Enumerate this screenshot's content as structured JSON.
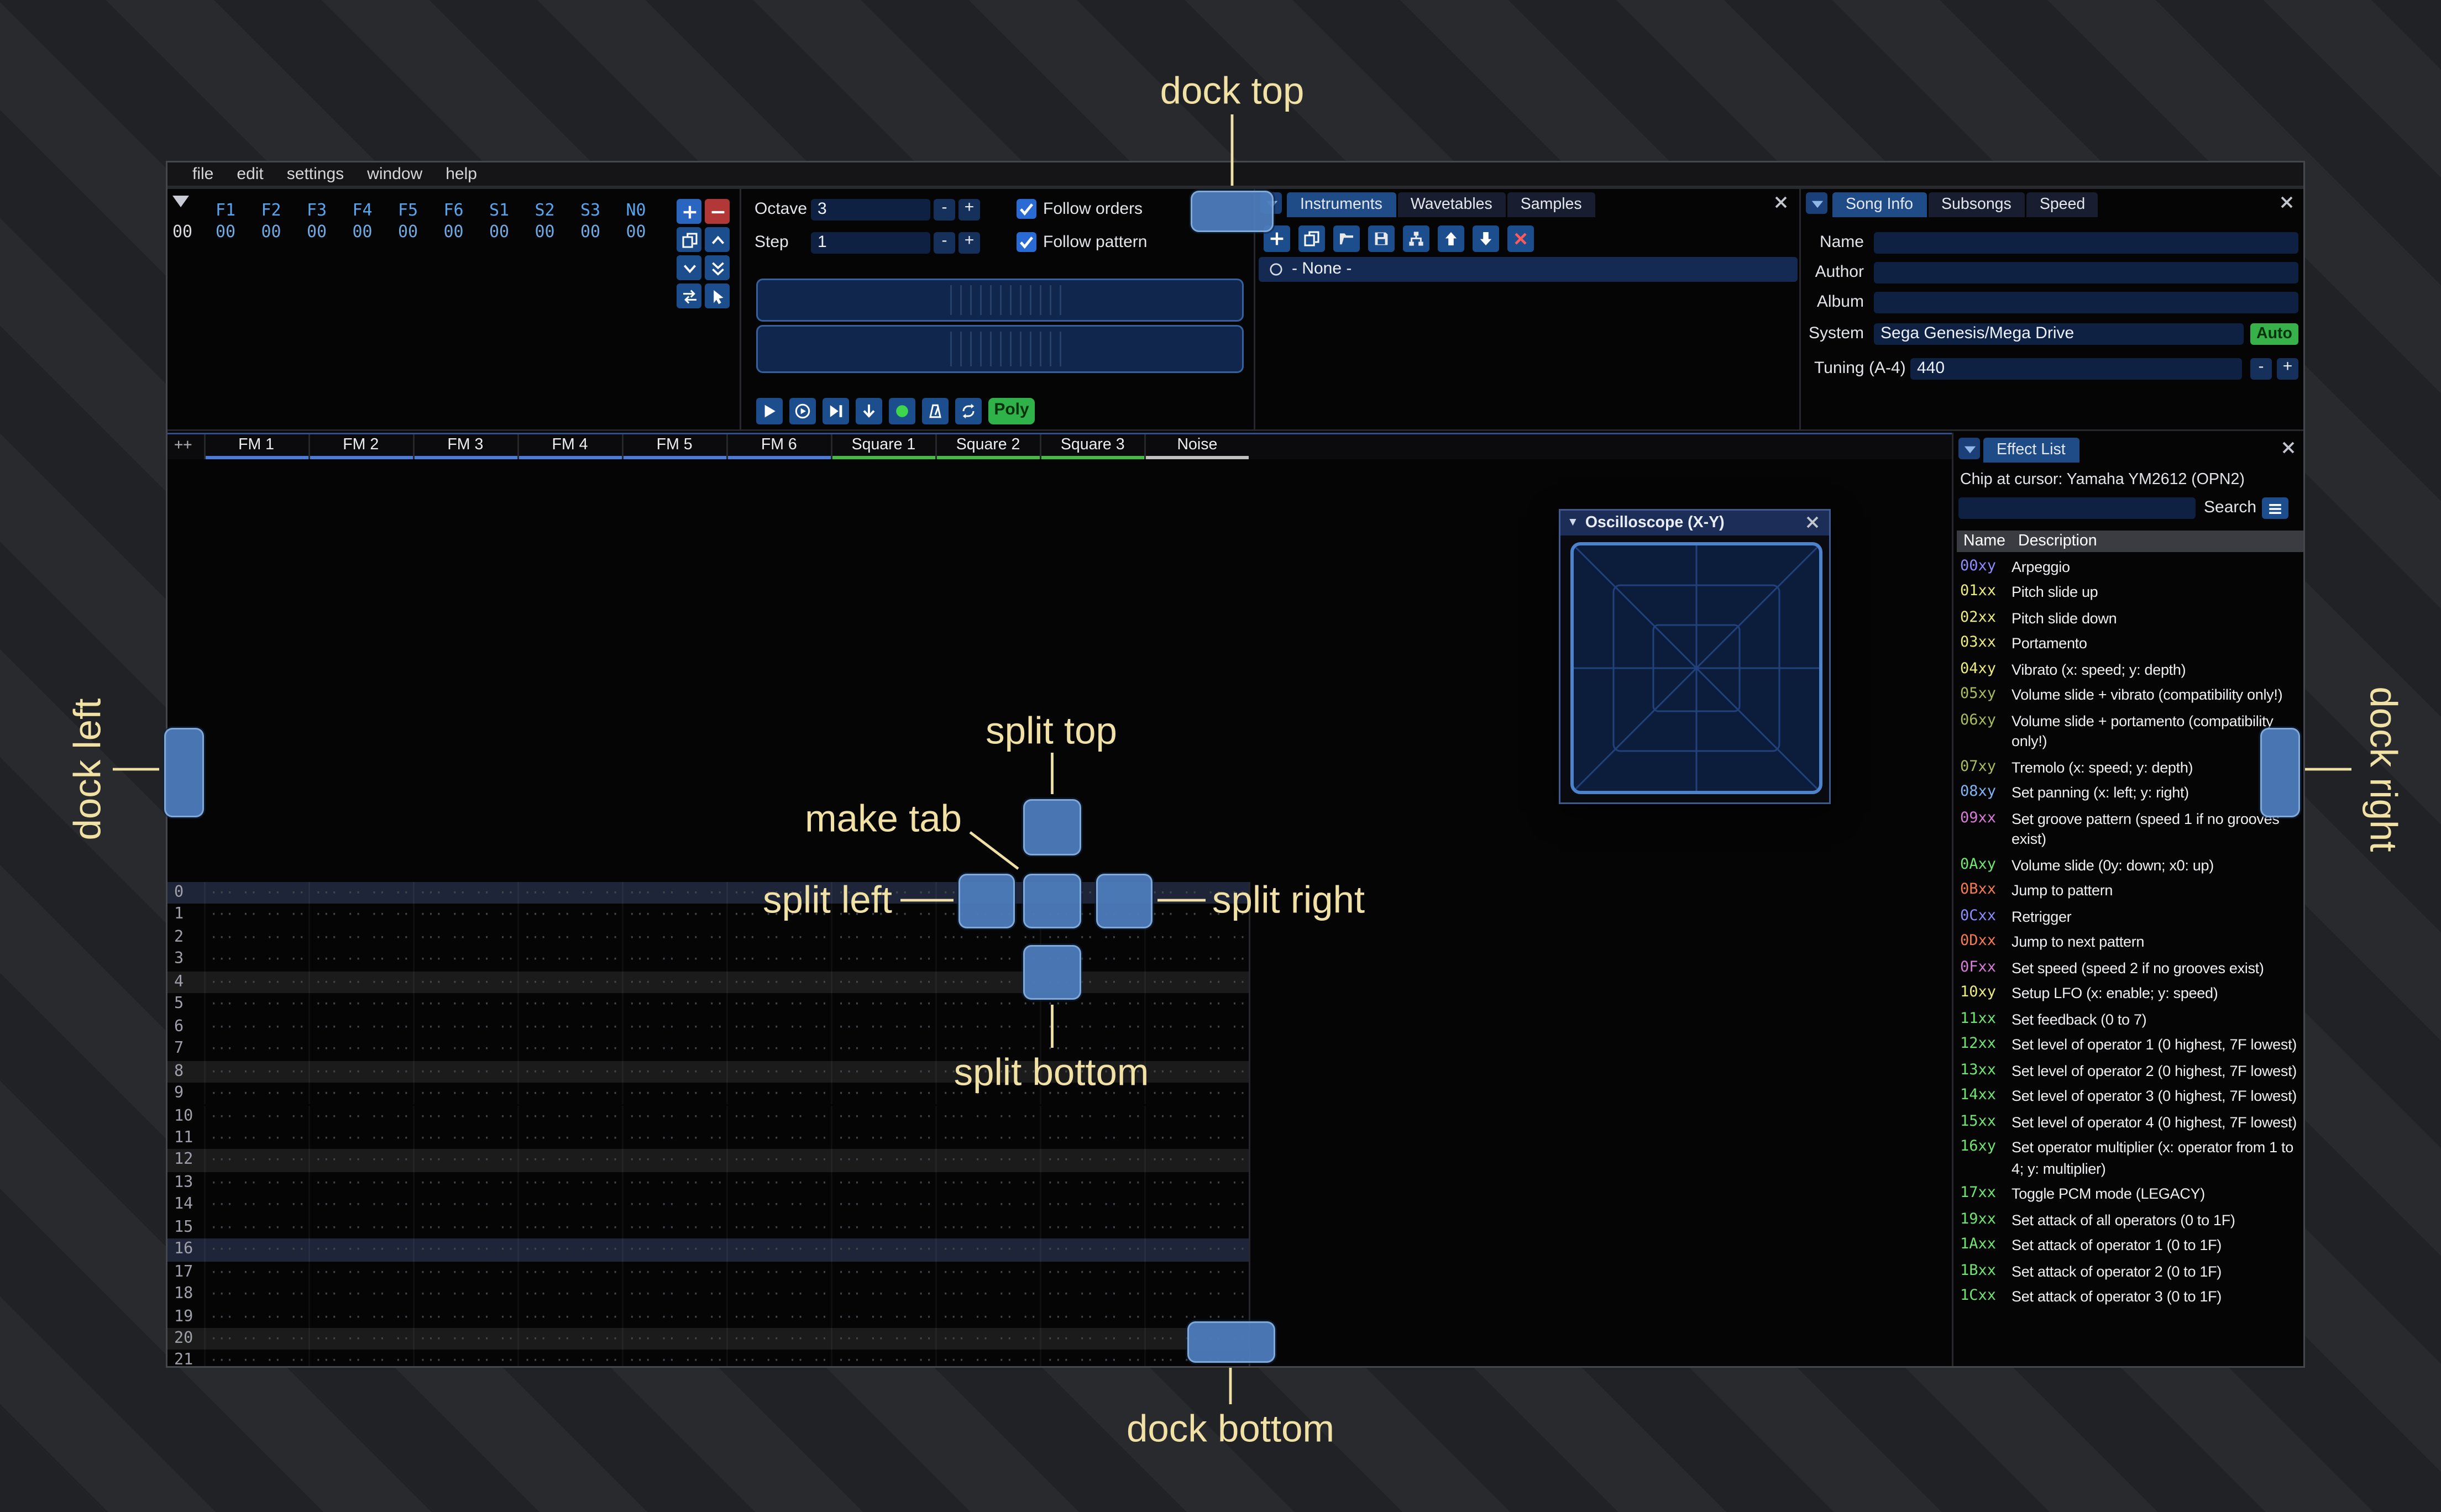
{
  "menu": {
    "items": [
      "file",
      "edit",
      "settings",
      "window",
      "help"
    ]
  },
  "orders": {
    "columns": [
      "F1",
      "F2",
      "F3",
      "F4",
      "F5",
      "F6",
      "S1",
      "S2",
      "S3",
      "N0"
    ],
    "rows": [
      {
        "label": "00",
        "values": [
          "00",
          "00",
          "00",
          "00",
          "00",
          "00",
          "00",
          "00",
          "00",
          "00"
        ]
      }
    ],
    "buttons": [
      {
        "name": "add-order-button",
        "icon": "plus"
      },
      {
        "name": "remove-order-button",
        "icon": "minus"
      },
      {
        "name": "duplicate-order-button",
        "icon": "copy"
      },
      {
        "name": "move-order-up-button",
        "icon": "chevron-up"
      },
      {
        "name": "move-order-down-button",
        "icon": "chevron-down"
      },
      {
        "name": "duplicate-order-end-button",
        "icon": "double-chevron-down"
      },
      {
        "name": "order-change-mode-button",
        "icon": "swap"
      },
      {
        "name": "order-edit-mode-button",
        "icon": "pointer"
      }
    ]
  },
  "controls": {
    "octave_label": "Octave",
    "octave_value": "3",
    "step_label": "Step",
    "step_value": "1",
    "minus_label": "-",
    "plus_label": "+",
    "follow_orders_label": "Follow orders",
    "follow_pattern_label": "Follow pattern",
    "poly_label": "Poly",
    "transport": [
      {
        "name": "play-button",
        "icon": "play"
      },
      {
        "name": "play-song-button",
        "icon": "play-circle"
      },
      {
        "name": "play-row-button",
        "icon": "step-row"
      },
      {
        "name": "step-down-button",
        "icon": "arrow-down"
      },
      {
        "name": "record-button",
        "icon": "record"
      },
      {
        "name": "metronome-button",
        "icon": "metronome"
      },
      {
        "name": "repeat-button",
        "icon": "repeat"
      }
    ]
  },
  "instruments": {
    "tabs": [
      {
        "label": "Instruments",
        "active": true
      },
      {
        "label": "Wavetables",
        "active": false
      },
      {
        "label": "Samples",
        "active": false
      }
    ],
    "toolbar": [
      {
        "name": "add-instrument-button",
        "icon": "plus"
      },
      {
        "name": "duplicate-instrument-button",
        "icon": "copy"
      },
      {
        "name": "open-instrument-button",
        "icon": "folder-open"
      },
      {
        "name": "save-instrument-button",
        "icon": "save"
      },
      {
        "name": "instrument-folders-button",
        "icon": "tree"
      },
      {
        "name": "move-instrument-up-button",
        "icon": "arrow-up-full"
      },
      {
        "name": "move-instrument-down-button",
        "icon": "arrow-down-full"
      },
      {
        "name": "delete-instrument-button",
        "icon": "close-red"
      }
    ],
    "items": [
      {
        "label": "- None -",
        "selected": true
      }
    ]
  },
  "song_info": {
    "tabs": [
      {
        "label": "Song Info",
        "active": true
      },
      {
        "label": "Subsongs",
        "active": false
      },
      {
        "label": "Speed",
        "active": false
      }
    ],
    "fields": [
      {
        "label": "Name",
        "value": ""
      },
      {
        "label": "Author",
        "value": ""
      },
      {
        "label": "Album",
        "value": ""
      },
      {
        "label": "System",
        "value": "Sega Genesis/Mega Drive",
        "button": "Auto"
      },
      {
        "label": "Tuning (A-4)",
        "value": "440",
        "stepper": true
      }
    ]
  },
  "pattern": {
    "expand_label": "++",
    "channels": [
      {
        "name": "FM 1",
        "color": "#4a7cdd"
      },
      {
        "name": "FM 2",
        "color": "#4a7cdd"
      },
      {
        "name": "FM 3",
        "color": "#4a7cdd"
      },
      {
        "name": "FM 4",
        "color": "#4a7cdd"
      },
      {
        "name": "FM 5",
        "color": "#4a7cdd"
      },
      {
        "name": "FM 6",
        "color": "#4a7cdd"
      },
      {
        "name": "Square 1",
        "color": "#42bd42"
      },
      {
        "name": "Square 2",
        "color": "#42bd42"
      },
      {
        "name": "Square 3",
        "color": "#42bd42"
      },
      {
        "name": "Noise",
        "color": "#c0c0c0"
      }
    ],
    "visible_rows": [
      "0",
      "1",
      "2",
      "3",
      "4",
      "5",
      "6",
      "7",
      "8",
      "9",
      "10",
      "11",
      "12",
      "13",
      "14",
      "15",
      "16",
      "17",
      "18",
      "19",
      "20",
      "21"
    ],
    "empty_cell": "··· ·· ·· ···"
  },
  "oscilloscope": {
    "title": "Oscilloscope (X-Y)"
  },
  "effect_list": {
    "title": "Effect List",
    "chip_label": "Chip at cursor: Yamaha YM2612 (OPN2)",
    "search_label": "Search",
    "search_value": "",
    "columns": [
      "Name",
      "Description"
    ],
    "effects": [
      {
        "code": "00xy",
        "desc": "Arpeggio",
        "color": "#8c8cff"
      },
      {
        "code": "01xx",
        "desc": "Pitch slide up",
        "color": "#ecec7c"
      },
      {
        "code": "02xx",
        "desc": "Pitch slide down",
        "color": "#ecec7c"
      },
      {
        "code": "03xx",
        "desc": "Portamento",
        "color": "#ecec7c"
      },
      {
        "code": "04xy",
        "desc": "Vibrato (x: speed; y: depth)",
        "color": "#ecec7c"
      },
      {
        "code": "05xy",
        "desc": "Volume slide + vibrato (compatibility only!)",
        "color": "#a8bc59"
      },
      {
        "code": "06xy",
        "desc": "Volume slide + portamento (compatibility only!)",
        "color": "#a8bc59"
      },
      {
        "code": "07xy",
        "desc": "Tremolo (x: speed; y: depth)",
        "color": "#a8bc59"
      },
      {
        "code": "08xy",
        "desc": "Set panning (x: left; y: right)",
        "color": "#7fb4f5"
      },
      {
        "code": "09xx",
        "desc": "Set groove pattern (speed 1 if no grooves exist)",
        "color": "#d87ad8"
      },
      {
        "code": "0Axy",
        "desc": "Volume slide (0y: down; x0: up)",
        "color": "#6fe66f"
      },
      {
        "code": "0Bxx",
        "desc": "Jump to pattern",
        "color": "#f57a52"
      },
      {
        "code": "0Cxx",
        "desc": "Retrigger",
        "color": "#8c8cff"
      },
      {
        "code": "0Dxx",
        "desc": "Jump to next pattern",
        "color": "#f57a52"
      },
      {
        "code": "0Fxx",
        "desc": "Set speed (speed 2 if no grooves exist)",
        "color": "#d87ad8"
      },
      {
        "code": "10xy",
        "desc": "Setup LFO (x: enable; y: speed)",
        "color": "#ecec7c"
      },
      {
        "code": "11xx",
        "desc": "Set feedback (0 to 7)",
        "color": "#6fe66f"
      },
      {
        "code": "12xx",
        "desc": "Set level of operator 1 (0 highest, 7F lowest)",
        "color": "#6fe66f"
      },
      {
        "code": "13xx",
        "desc": "Set level of operator 2 (0 highest, 7F lowest)",
        "color": "#6fe66f"
      },
      {
        "code": "14xx",
        "desc": "Set level of operator 3 (0 highest, 7F lowest)",
        "color": "#6fe66f"
      },
      {
        "code": "15xx",
        "desc": "Set level of operator 4 (0 highest, 7F lowest)",
        "color": "#6fe66f"
      },
      {
        "code": "16xy",
        "desc": "Set operator multiplier (x: operator from 1 to 4; y: multiplier)",
        "color": "#6fe66f"
      },
      {
        "code": "17xx",
        "desc": "Toggle PCM mode (LEGACY)",
        "color": "#6fe66f"
      },
      {
        "code": "19xx",
        "desc": "Set attack of all operators (0 to 1F)",
        "color": "#6fe66f"
      },
      {
        "code": "1Axx",
        "desc": "Set attack of operator 1 (0 to 1F)",
        "color": "#6fe66f"
      },
      {
        "code": "1Bxx",
        "desc": "Set attack of operator 2 (0 to 1F)",
        "color": "#6fe66f"
      },
      {
        "code": "1Cxx",
        "desc": "Set attack of operator 3 (0 to 1F)",
        "color": "#6fe66f"
      }
    ]
  },
  "overlay": {
    "dock_top": "dock top",
    "dock_bottom": "dock bottom",
    "dock_left": "dock left",
    "dock_right": "dock right",
    "split_top": "split top",
    "split_bottom": "split bottom",
    "split_left": "split left",
    "split_right": "split right",
    "make_tab": "make tab",
    "accent_color": "#f1e1a5"
  }
}
